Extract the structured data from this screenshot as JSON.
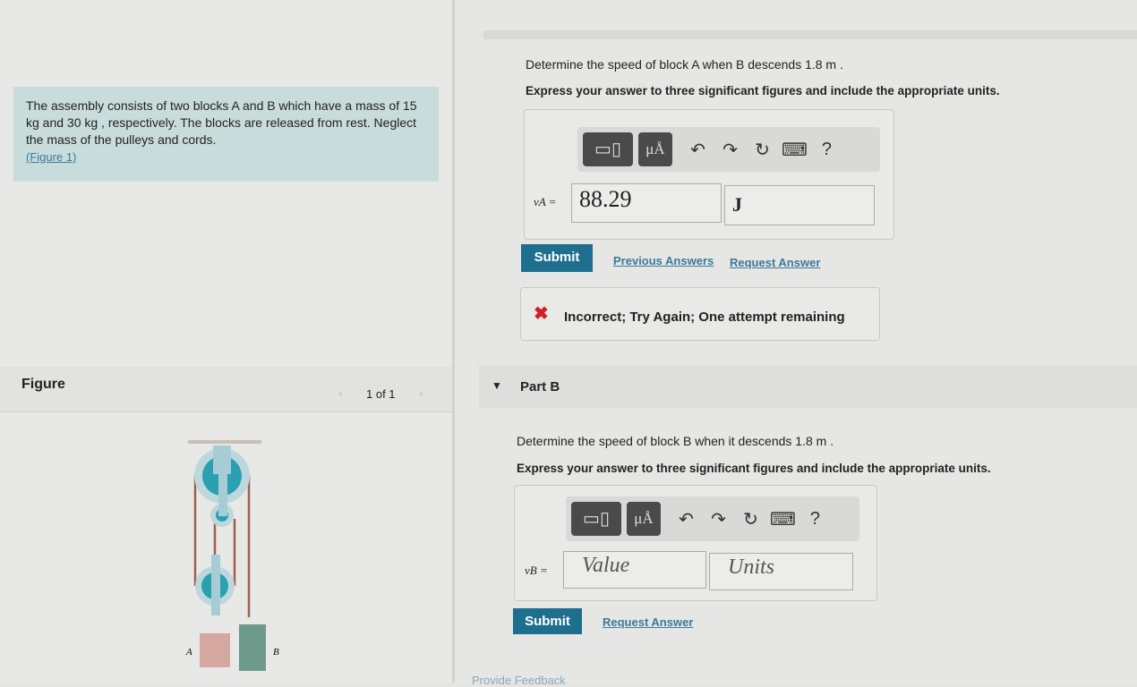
{
  "problem": {
    "text": "The assembly consists of two blocks A and B which have a mass of 15 kg and 30 kg , respectively. The blocks are released from rest. Neglect the mass of the pulleys and cords.",
    "figure_link": "(Figure 1)"
  },
  "figure": {
    "title": "Figure",
    "pager": "1 of 1",
    "label_a": "A",
    "label_b": "B",
    "colors": {
      "pulley": "#2aa0b0",
      "block_a": "#d4a8a0",
      "block_b": "#6e9a8c",
      "cord": "#a06050"
    }
  },
  "part_a": {
    "question": "Determine the speed of block A when B descends 1.8 m .",
    "instruction": "Express your answer to three significant figures and include the appropriate units.",
    "var_label": "vA =",
    "value": "88.29",
    "units": "J",
    "submit": "Submit",
    "previous_answers": "Previous Answers",
    "request_answer": "Request Answer",
    "feedback": "Incorrect; Try Again; One attempt remaining"
  },
  "part_b": {
    "title": "Part B",
    "question": "Determine the speed of block B when it descends 1.8 m .",
    "instruction": "Express your answer to three significant figures and include the appropriate units.",
    "var_label": "vB =",
    "value_placeholder": "Value",
    "units_placeholder": "Units",
    "submit": "Submit",
    "request_answer": "Request Answer"
  },
  "toolbar": {
    "templates": "▭▯",
    "units": "μÅ",
    "undo": "↶",
    "redo": "↷",
    "reset": "↻",
    "keyboard": "⌨",
    "help": "?"
  },
  "footer": {
    "feedback": "Provide Feedback"
  }
}
